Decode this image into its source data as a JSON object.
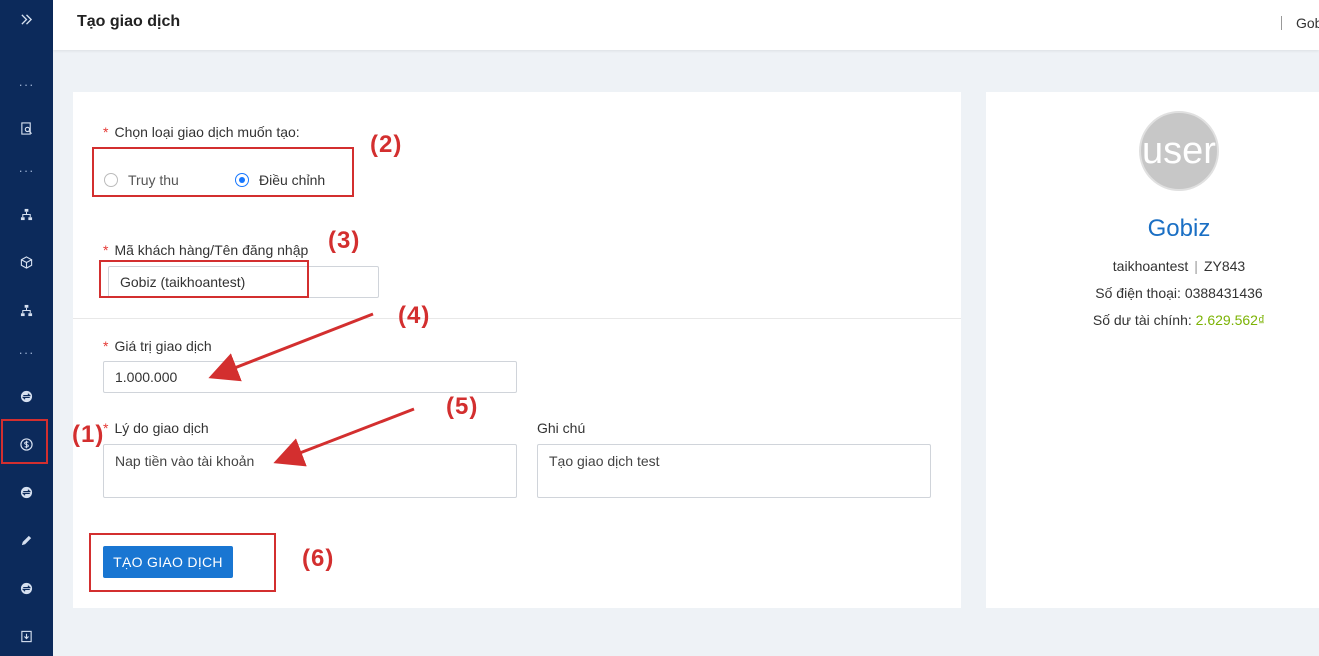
{
  "header": {
    "title": "Tạo giao dịch",
    "user": "Gob"
  },
  "sidebar": {
    "items": [
      {
        "icon": "double-chevron-right-icon"
      },
      {
        "icon": "more-dots-icon"
      },
      {
        "icon": "receipt-search-icon"
      },
      {
        "icon": "more-dots-icon"
      },
      {
        "icon": "sitemap-icon"
      },
      {
        "icon": "cube-icon"
      },
      {
        "icon": "sitemap-icon"
      },
      {
        "icon": "more-dots-icon"
      },
      {
        "icon": "exchange-icon"
      },
      {
        "icon": "dollar-circle-icon"
      },
      {
        "icon": "exchange-icon"
      },
      {
        "icon": "pencil-icon"
      },
      {
        "icon": "exchange-icon"
      },
      {
        "icon": "download-box-icon"
      }
    ],
    "dots": "···"
  },
  "form": {
    "type_label": "Chọn loại giao dịch muốn tạo:",
    "type_options": [
      "Truy thu",
      "Điều chỉnh"
    ],
    "type_selected": "Điều chỉnh",
    "customer_label": "Mã khách hàng/Tên đăng nhập",
    "customer_value": "Gobiz (taikhoantest)",
    "amount_label": "Giá trị giao dịch",
    "amount_value": "1.000.000",
    "reason_label": "Lý do giao dịch",
    "reason_value": "Nap tiền vào tài khoản",
    "note_label": "Ghi chú",
    "note_value": "Tạo giao dịch test",
    "required_mark": "*",
    "submit_label": "TẠO GIAO DỊCH"
  },
  "profile": {
    "avatar_text": "user",
    "name": "Gobiz",
    "account": "taikhoantest",
    "code": "ZY843",
    "phone_label": "Số điện thoại:",
    "phone": "0388431436",
    "balance_label": "Số dư tài chính:",
    "balance": "2.629.562₫"
  },
  "annotations": {
    "n1": "(1)",
    "n2": "(2)",
    "n3": "(3)",
    "n4": "(4)",
    "n5": "(5)",
    "n6": "(6)",
    "color": "#d32f2f"
  },
  "colors": {
    "sidebar": "#0c2a5b",
    "primary": "#1976d2",
    "link": "#1a6fc4",
    "balance": "#7cb305"
  }
}
